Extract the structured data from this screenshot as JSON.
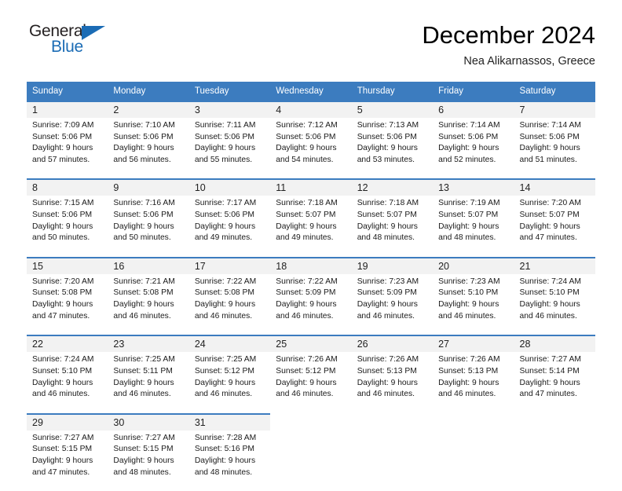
{
  "brand": {
    "name_part1": "General",
    "name_part2": "Blue",
    "triangle_color": "#1b6cb5"
  },
  "header": {
    "title": "December 2024",
    "subtitle": "Nea Alikarnassos, Greece"
  },
  "theme": {
    "header_blue": "#3c7cbf",
    "daynum_band": "#f2f2f2"
  },
  "calendar": {
    "weekday_headers": [
      "Sunday",
      "Monday",
      "Tuesday",
      "Wednesday",
      "Thursday",
      "Friday",
      "Saturday"
    ],
    "weeks": [
      {
        "days": [
          {
            "num": "1",
            "sunrise": "Sunrise: 7:09 AM",
            "sunset": "Sunset: 5:06 PM",
            "daylight1": "Daylight: 9 hours",
            "daylight2": "and 57 minutes."
          },
          {
            "num": "2",
            "sunrise": "Sunrise: 7:10 AM",
            "sunset": "Sunset: 5:06 PM",
            "daylight1": "Daylight: 9 hours",
            "daylight2": "and 56 minutes."
          },
          {
            "num": "3",
            "sunrise": "Sunrise: 7:11 AM",
            "sunset": "Sunset: 5:06 PM",
            "daylight1": "Daylight: 9 hours",
            "daylight2": "and 55 minutes."
          },
          {
            "num": "4",
            "sunrise": "Sunrise: 7:12 AM",
            "sunset": "Sunset: 5:06 PM",
            "daylight1": "Daylight: 9 hours",
            "daylight2": "and 54 minutes."
          },
          {
            "num": "5",
            "sunrise": "Sunrise: 7:13 AM",
            "sunset": "Sunset: 5:06 PM",
            "daylight1": "Daylight: 9 hours",
            "daylight2": "and 53 minutes."
          },
          {
            "num": "6",
            "sunrise": "Sunrise: 7:14 AM",
            "sunset": "Sunset: 5:06 PM",
            "daylight1": "Daylight: 9 hours",
            "daylight2": "and 52 minutes."
          },
          {
            "num": "7",
            "sunrise": "Sunrise: 7:14 AM",
            "sunset": "Sunset: 5:06 PM",
            "daylight1": "Daylight: 9 hours",
            "daylight2": "and 51 minutes."
          }
        ]
      },
      {
        "days": [
          {
            "num": "8",
            "sunrise": "Sunrise: 7:15 AM",
            "sunset": "Sunset: 5:06 PM",
            "daylight1": "Daylight: 9 hours",
            "daylight2": "and 50 minutes."
          },
          {
            "num": "9",
            "sunrise": "Sunrise: 7:16 AM",
            "sunset": "Sunset: 5:06 PM",
            "daylight1": "Daylight: 9 hours",
            "daylight2": "and 50 minutes."
          },
          {
            "num": "10",
            "sunrise": "Sunrise: 7:17 AM",
            "sunset": "Sunset: 5:06 PM",
            "daylight1": "Daylight: 9 hours",
            "daylight2": "and 49 minutes."
          },
          {
            "num": "11",
            "sunrise": "Sunrise: 7:18 AM",
            "sunset": "Sunset: 5:07 PM",
            "daylight1": "Daylight: 9 hours",
            "daylight2": "and 49 minutes."
          },
          {
            "num": "12",
            "sunrise": "Sunrise: 7:18 AM",
            "sunset": "Sunset: 5:07 PM",
            "daylight1": "Daylight: 9 hours",
            "daylight2": "and 48 minutes."
          },
          {
            "num": "13",
            "sunrise": "Sunrise: 7:19 AM",
            "sunset": "Sunset: 5:07 PM",
            "daylight1": "Daylight: 9 hours",
            "daylight2": "and 48 minutes."
          },
          {
            "num": "14",
            "sunrise": "Sunrise: 7:20 AM",
            "sunset": "Sunset: 5:07 PM",
            "daylight1": "Daylight: 9 hours",
            "daylight2": "and 47 minutes."
          }
        ]
      },
      {
        "days": [
          {
            "num": "15",
            "sunrise": "Sunrise: 7:20 AM",
            "sunset": "Sunset: 5:08 PM",
            "daylight1": "Daylight: 9 hours",
            "daylight2": "and 47 minutes."
          },
          {
            "num": "16",
            "sunrise": "Sunrise: 7:21 AM",
            "sunset": "Sunset: 5:08 PM",
            "daylight1": "Daylight: 9 hours",
            "daylight2": "and 46 minutes."
          },
          {
            "num": "17",
            "sunrise": "Sunrise: 7:22 AM",
            "sunset": "Sunset: 5:08 PM",
            "daylight1": "Daylight: 9 hours",
            "daylight2": "and 46 minutes."
          },
          {
            "num": "18",
            "sunrise": "Sunrise: 7:22 AM",
            "sunset": "Sunset: 5:09 PM",
            "daylight1": "Daylight: 9 hours",
            "daylight2": "and 46 minutes."
          },
          {
            "num": "19",
            "sunrise": "Sunrise: 7:23 AM",
            "sunset": "Sunset: 5:09 PM",
            "daylight1": "Daylight: 9 hours",
            "daylight2": "and 46 minutes."
          },
          {
            "num": "20",
            "sunrise": "Sunrise: 7:23 AM",
            "sunset": "Sunset: 5:10 PM",
            "daylight1": "Daylight: 9 hours",
            "daylight2": "and 46 minutes."
          },
          {
            "num": "21",
            "sunrise": "Sunrise: 7:24 AM",
            "sunset": "Sunset: 5:10 PM",
            "daylight1": "Daylight: 9 hours",
            "daylight2": "and 46 minutes."
          }
        ]
      },
      {
        "days": [
          {
            "num": "22",
            "sunrise": "Sunrise: 7:24 AM",
            "sunset": "Sunset: 5:10 PM",
            "daylight1": "Daylight: 9 hours",
            "daylight2": "and 46 minutes."
          },
          {
            "num": "23",
            "sunrise": "Sunrise: 7:25 AM",
            "sunset": "Sunset: 5:11 PM",
            "daylight1": "Daylight: 9 hours",
            "daylight2": "and 46 minutes."
          },
          {
            "num": "24",
            "sunrise": "Sunrise: 7:25 AM",
            "sunset": "Sunset: 5:12 PM",
            "daylight1": "Daylight: 9 hours",
            "daylight2": "and 46 minutes."
          },
          {
            "num": "25",
            "sunrise": "Sunrise: 7:26 AM",
            "sunset": "Sunset: 5:12 PM",
            "daylight1": "Daylight: 9 hours",
            "daylight2": "and 46 minutes."
          },
          {
            "num": "26",
            "sunrise": "Sunrise: 7:26 AM",
            "sunset": "Sunset: 5:13 PM",
            "daylight1": "Daylight: 9 hours",
            "daylight2": "and 46 minutes."
          },
          {
            "num": "27",
            "sunrise": "Sunrise: 7:26 AM",
            "sunset": "Sunset: 5:13 PM",
            "daylight1": "Daylight: 9 hours",
            "daylight2": "and 46 minutes."
          },
          {
            "num": "28",
            "sunrise": "Sunrise: 7:27 AM",
            "sunset": "Sunset: 5:14 PM",
            "daylight1": "Daylight: 9 hours",
            "daylight2": "and 47 minutes."
          }
        ]
      },
      {
        "days": [
          {
            "num": "29",
            "sunrise": "Sunrise: 7:27 AM",
            "sunset": "Sunset: 5:15 PM",
            "daylight1": "Daylight: 9 hours",
            "daylight2": "and 47 minutes."
          },
          {
            "num": "30",
            "sunrise": "Sunrise: 7:27 AM",
            "sunset": "Sunset: 5:15 PM",
            "daylight1": "Daylight: 9 hours",
            "daylight2": "and 48 minutes."
          },
          {
            "num": "31",
            "sunrise": "Sunrise: 7:28 AM",
            "sunset": "Sunset: 5:16 PM",
            "daylight1": "Daylight: 9 hours",
            "daylight2": "and 48 minutes."
          },
          {
            "num": "",
            "sunrise": "",
            "sunset": "",
            "daylight1": "",
            "daylight2": ""
          },
          {
            "num": "",
            "sunrise": "",
            "sunset": "",
            "daylight1": "",
            "daylight2": ""
          },
          {
            "num": "",
            "sunrise": "",
            "sunset": "",
            "daylight1": "",
            "daylight2": ""
          },
          {
            "num": "",
            "sunrise": "",
            "sunset": "",
            "daylight1": "",
            "daylight2": ""
          }
        ]
      }
    ]
  }
}
